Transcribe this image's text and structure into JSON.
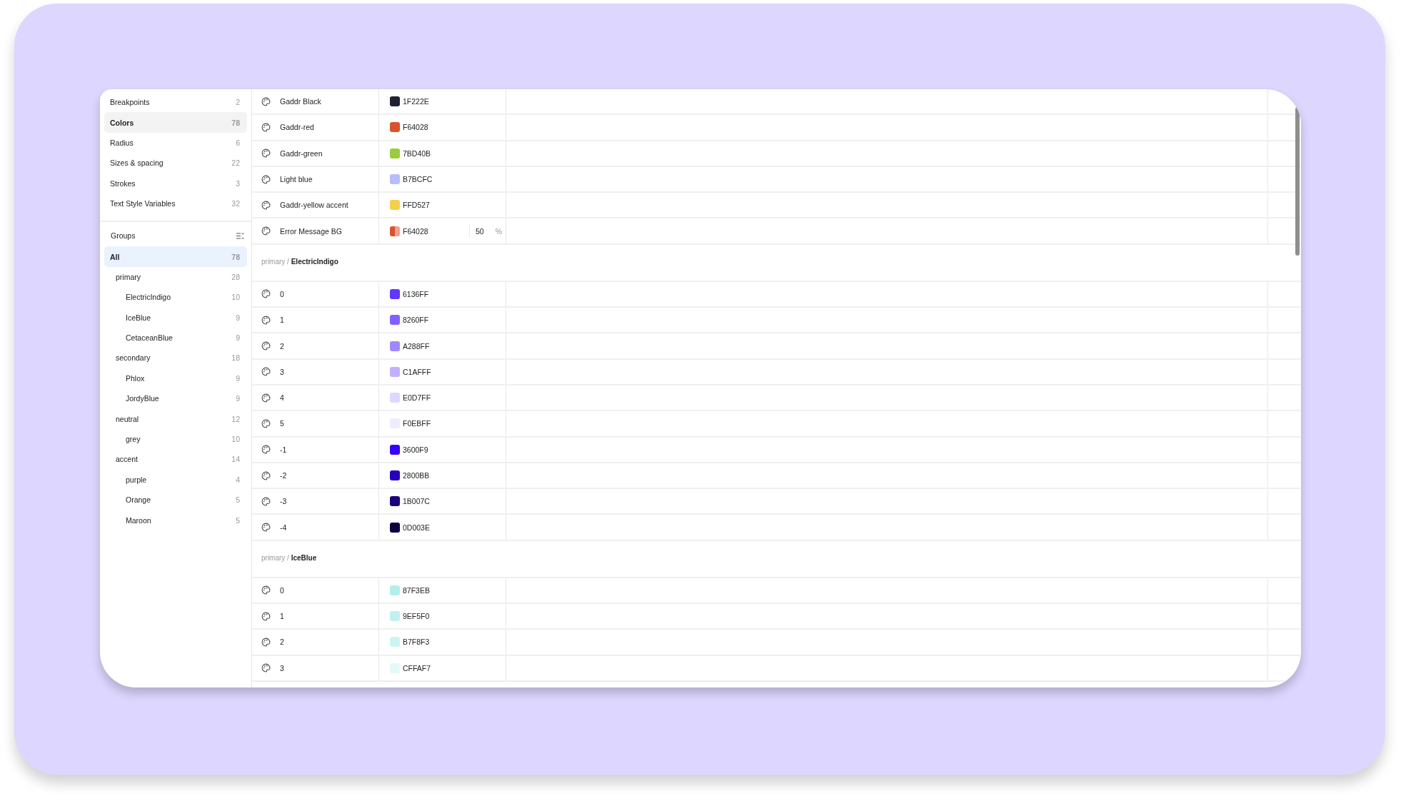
{
  "sidebar": {
    "categories": [
      {
        "label": "Breakpoints",
        "count": "2",
        "selected": false
      },
      {
        "label": "Colors",
        "count": "78",
        "selected": true
      },
      {
        "label": "Radius",
        "count": "6",
        "selected": false
      },
      {
        "label": "Sizes & spacing",
        "count": "22",
        "selected": false
      },
      {
        "label": "Strokes",
        "count": "3",
        "selected": false
      },
      {
        "label": "Text Style Variables",
        "count": "32",
        "selected": false
      }
    ],
    "groups_title": "Groups",
    "groups": [
      {
        "label": "All",
        "count": "78",
        "selected": true
      },
      {
        "label": "primary",
        "count": "28",
        "selected": false,
        "children": [
          {
            "label": "ElectricIndigo",
            "count": "10",
            "selected": false
          },
          {
            "label": "IceBlue",
            "count": "9",
            "selected": false
          },
          {
            "label": "CetaceanBlue",
            "count": "9",
            "selected": false
          }
        ]
      },
      {
        "label": "secondary",
        "count": "18",
        "selected": false,
        "children": [
          {
            "label": "Phlox",
            "count": "9",
            "selected": false
          },
          {
            "label": "JordyBlue",
            "count": "9",
            "selected": false
          }
        ]
      },
      {
        "label": "neutral",
        "count": "12",
        "selected": false,
        "children": [
          {
            "label": "grey",
            "count": "10",
            "selected": false
          }
        ]
      },
      {
        "label": "accent",
        "count": "14",
        "selected": false,
        "children": [
          {
            "label": "purple",
            "count": "4",
            "selected": false
          },
          {
            "label": "Orange",
            "count": "5",
            "selected": false
          },
          {
            "label": "Maroon",
            "count": "5",
            "selected": false
          }
        ]
      }
    ]
  },
  "sections": [
    {
      "rows": [
        {
          "name": "Gaddr Black",
          "hex": "1F222E",
          "color": "#1f222e"
        },
        {
          "name": "Gaddr-red",
          "hex": "F64028",
          "color": "#d9532c"
        },
        {
          "name": "Gaddr-green",
          "hex": "7BD40B",
          "color": "#9ccc3c"
        },
        {
          "name": "Light blue",
          "hex": "B7BCFC",
          "color": "#b7bcfc"
        },
        {
          "name": "Gaddr-yellow accent",
          "hex": "FFD527",
          "color": "#f5d04a"
        },
        {
          "name": "Error Message BG",
          "hex": "F64028",
          "color": "#d9532c",
          "opacity": "50",
          "unit": "%"
        }
      ]
    },
    {
      "path_prefix": "primary /",
      "path_name": "ElectricIndigo",
      "rows": [
        {
          "name": "0",
          "hex": "6136FF",
          "color": "#6136ff"
        },
        {
          "name": "1",
          "hex": "8260FF",
          "color": "#8260ff"
        },
        {
          "name": "2",
          "hex": "A288FF",
          "color": "#a288ff"
        },
        {
          "name": "3",
          "hex": "C1AFFF",
          "color": "#c1afff"
        },
        {
          "name": "4",
          "hex": "E0D7FF",
          "color": "#e0d7ff"
        },
        {
          "name": "5",
          "hex": "F0EBFF",
          "color": "#f0ebff"
        },
        {
          "name": "-1",
          "hex": "3600F9",
          "color": "#3600f9"
        },
        {
          "name": "-2",
          "hex": "2800BB",
          "color": "#2800bb"
        },
        {
          "name": "-3",
          "hex": "1B007C",
          "color": "#1b007c"
        },
        {
          "name": "-4",
          "hex": "0D003E",
          "color": "#0d003e"
        }
      ]
    },
    {
      "path_prefix": "primary /",
      "path_name": "IceBlue",
      "rows": [
        {
          "name": "0",
          "hex": "87F3EB",
          "color": "#b2efea"
        },
        {
          "name": "1",
          "hex": "9EF5F0",
          "color": "#c0f1ee"
        },
        {
          "name": "2",
          "hex": "B7F8F3",
          "color": "#ccf5f2"
        },
        {
          "name": "3",
          "hex": "CFFAF7",
          "color": "#e2f9f7"
        }
      ]
    }
  ]
}
